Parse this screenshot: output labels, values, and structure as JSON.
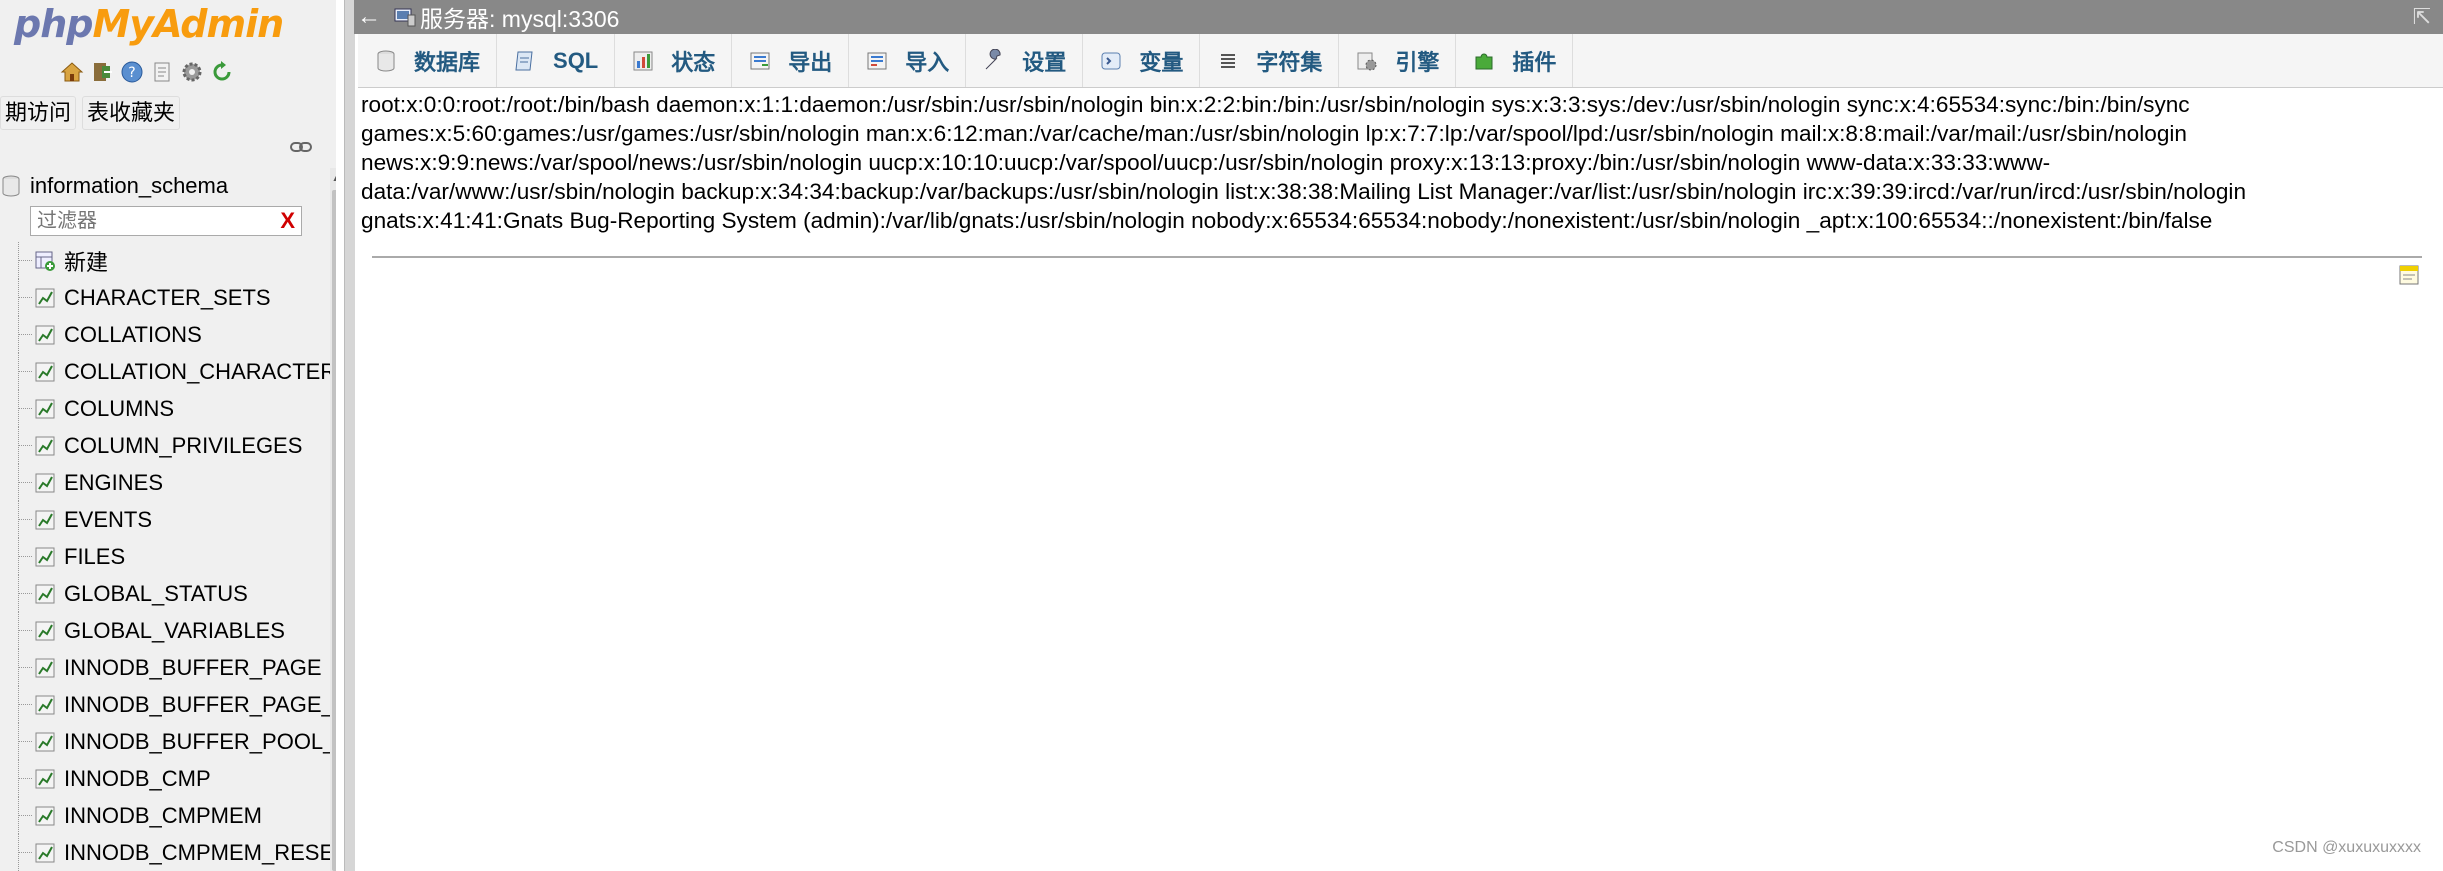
{
  "logo": {
    "php": "php",
    "my": "My",
    "admin": "Admin"
  },
  "nav": {
    "icons": [
      "home-icon",
      "exit-icon",
      "query-icon",
      "docs-icon",
      "settings-icon",
      "reload-icon"
    ],
    "tabs": [
      "期访问",
      "表收藏夹"
    ],
    "database": "information_schema",
    "filter_placeholder": "过滤器",
    "filter_clear": "X",
    "tree_items": [
      "新建",
      "CHARACTER_SETS",
      "COLLATIONS",
      "COLLATION_CHARACTER",
      "COLUMNS",
      "COLUMN_PRIVILEGES",
      "ENGINES",
      "EVENTS",
      "FILES",
      "GLOBAL_STATUS",
      "GLOBAL_VARIABLES",
      "INNODB_BUFFER_PAGE",
      "INNODB_BUFFER_PAGE_L",
      "INNODB_BUFFER_POOL_S",
      "INNODB_CMP",
      "INNODB_CMPMEM",
      "INNODB_CMPMEM_RESE"
    ]
  },
  "serverbar": {
    "collapse": "←",
    "label": "服务器: mysql:3306",
    "maximize": "⇱"
  },
  "tabs": [
    {
      "label": "数据库",
      "icon": "database-icon"
    },
    {
      "label": "SQL",
      "icon": "sql-icon"
    },
    {
      "label": "状态",
      "icon": "status-icon"
    },
    {
      "label": "导出",
      "icon": "export-icon"
    },
    {
      "label": "导入",
      "icon": "import-icon"
    },
    {
      "label": "设置",
      "icon": "wrench-icon"
    },
    {
      "label": "变量",
      "icon": "variables-icon"
    },
    {
      "label": "字符集",
      "icon": "charset-icon"
    },
    {
      "label": "引擎",
      "icon": "engine-icon"
    },
    {
      "label": "插件",
      "icon": "plugin-icon"
    }
  ],
  "content_lines": [
    "root:x:0:0:root:/root:/bin/bash daemon:x:1:1:daemon:/usr/sbin:/usr/sbin/nologin bin:x:2:2:bin:/bin:/usr/sbin/nologin sys:x:3:3:sys:/dev:/usr/sbin/nologin sync:x:4:65534:sync:/bin:/bin/sync",
    "games:x:5:60:games:/usr/games:/usr/sbin/nologin man:x:6:12:man:/var/cache/man:/usr/sbin/nologin lp:x:7:7:lp:/var/spool/lpd:/usr/sbin/nologin mail:x:8:8:mail:/var/mail:/usr/sbin/nologin",
    "news:x:9:9:news:/var/spool/news:/usr/sbin/nologin uucp:x:10:10:uucp:/var/spool/uucp:/usr/sbin/nologin proxy:x:13:13:proxy:/bin:/usr/sbin/nologin www-data:x:33:33:www-",
    "data:/var/www:/usr/sbin/nologin backup:x:34:34:backup:/var/backups:/usr/sbin/nologin list:x:38:38:Mailing List Manager:/var/list:/usr/sbin/nologin irc:x:39:39:ircd:/var/run/ircd:/usr/sbin/nologin",
    "gnats:x:41:41:Gnats Bug-Reporting System (admin):/var/lib/gnats:/usr/sbin/nologin nobody:x:65534:65534:nobody:/nonexistent:/usr/sbin/nologin _apt:x:100:65534::/nonexistent:/bin/false"
  ],
  "watermark": "CSDN @xuxuxuxxxx"
}
